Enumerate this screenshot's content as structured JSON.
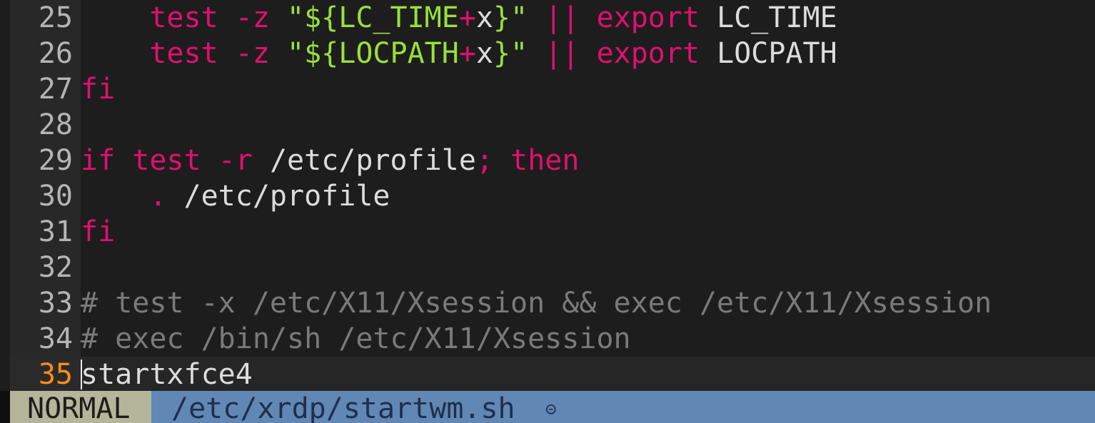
{
  "editor": {
    "lines": [
      {
        "num": "25",
        "tokens": [
          {
            "t": "    ",
            "c": "plain"
          },
          {
            "t": "test",
            "c": "kw"
          },
          {
            "t": " ",
            "c": "plain"
          },
          {
            "t": "-z",
            "c": "kw"
          },
          {
            "t": " ",
            "c": "plain"
          },
          {
            "t": "\"${LC_TIME",
            "c": "str"
          },
          {
            "t": "+",
            "c": "kw"
          },
          {
            "t": "x",
            "c": "plain"
          },
          {
            "t": "}\"",
            "c": "str"
          },
          {
            "t": " ",
            "c": "plain"
          },
          {
            "t": "||",
            "c": "kw"
          },
          {
            "t": " ",
            "c": "plain"
          },
          {
            "t": "export",
            "c": "kw"
          },
          {
            "t": " LC_TIME",
            "c": "plain"
          }
        ]
      },
      {
        "num": "26",
        "tokens": [
          {
            "t": "    ",
            "c": "plain"
          },
          {
            "t": "test",
            "c": "kw"
          },
          {
            "t": " ",
            "c": "plain"
          },
          {
            "t": "-z",
            "c": "kw"
          },
          {
            "t": " ",
            "c": "plain"
          },
          {
            "t": "\"${LOCPATH",
            "c": "str"
          },
          {
            "t": "+",
            "c": "kw"
          },
          {
            "t": "x",
            "c": "plain"
          },
          {
            "t": "}\"",
            "c": "str"
          },
          {
            "t": " ",
            "c": "plain"
          },
          {
            "t": "||",
            "c": "kw"
          },
          {
            "t": " ",
            "c": "plain"
          },
          {
            "t": "export",
            "c": "kw"
          },
          {
            "t": " LOCPATH",
            "c": "plain"
          }
        ]
      },
      {
        "num": "27",
        "tokens": [
          {
            "t": "fi",
            "c": "kw"
          }
        ]
      },
      {
        "num": "28",
        "tokens": []
      },
      {
        "num": "29",
        "tokens": [
          {
            "t": "if",
            "c": "kw"
          },
          {
            "t": " ",
            "c": "plain"
          },
          {
            "t": "test",
            "c": "kw"
          },
          {
            "t": " ",
            "c": "plain"
          },
          {
            "t": "-r",
            "c": "kw"
          },
          {
            "t": " /etc/profile",
            "c": "plain"
          },
          {
            "t": ";",
            "c": "kw"
          },
          {
            "t": " ",
            "c": "plain"
          },
          {
            "t": "then",
            "c": "kw"
          }
        ]
      },
      {
        "num": "30",
        "tokens": [
          {
            "t": "    ",
            "c": "plain"
          },
          {
            "t": ".",
            "c": "kw"
          },
          {
            "t": " /etc/profile",
            "c": "plain"
          }
        ]
      },
      {
        "num": "31",
        "tokens": [
          {
            "t": "fi",
            "c": "kw"
          }
        ]
      },
      {
        "num": "32",
        "tokens": []
      },
      {
        "num": "33",
        "tokens": [
          {
            "t": "# test -x /etc/X11/Xsession && exec /etc/X11/Xsession",
            "c": "cmt"
          }
        ]
      },
      {
        "num": "34",
        "tokens": [
          {
            "t": "# exec /bin/sh /etc/X11/Xsession",
            "c": "cmt"
          }
        ]
      },
      {
        "num": "35",
        "current": true,
        "tokens": [
          {
            "t": "startxfce4",
            "c": "plain"
          }
        ]
      }
    ]
  },
  "statusline": {
    "mode": "NORMAL",
    "filename": "/etc/xrdp/startwm.sh",
    "icon": "⊝",
    "icon_name": "readonly-indicator-icon"
  },
  "colors": {
    "background": "#1d1d1d",
    "keyword": "#e0106f",
    "string": "#98e03c",
    "comment": "#7a7a7a",
    "current_line_number": "#ff8c1a",
    "statusline": "#6187b5",
    "mode_background": "#b5b59a"
  }
}
